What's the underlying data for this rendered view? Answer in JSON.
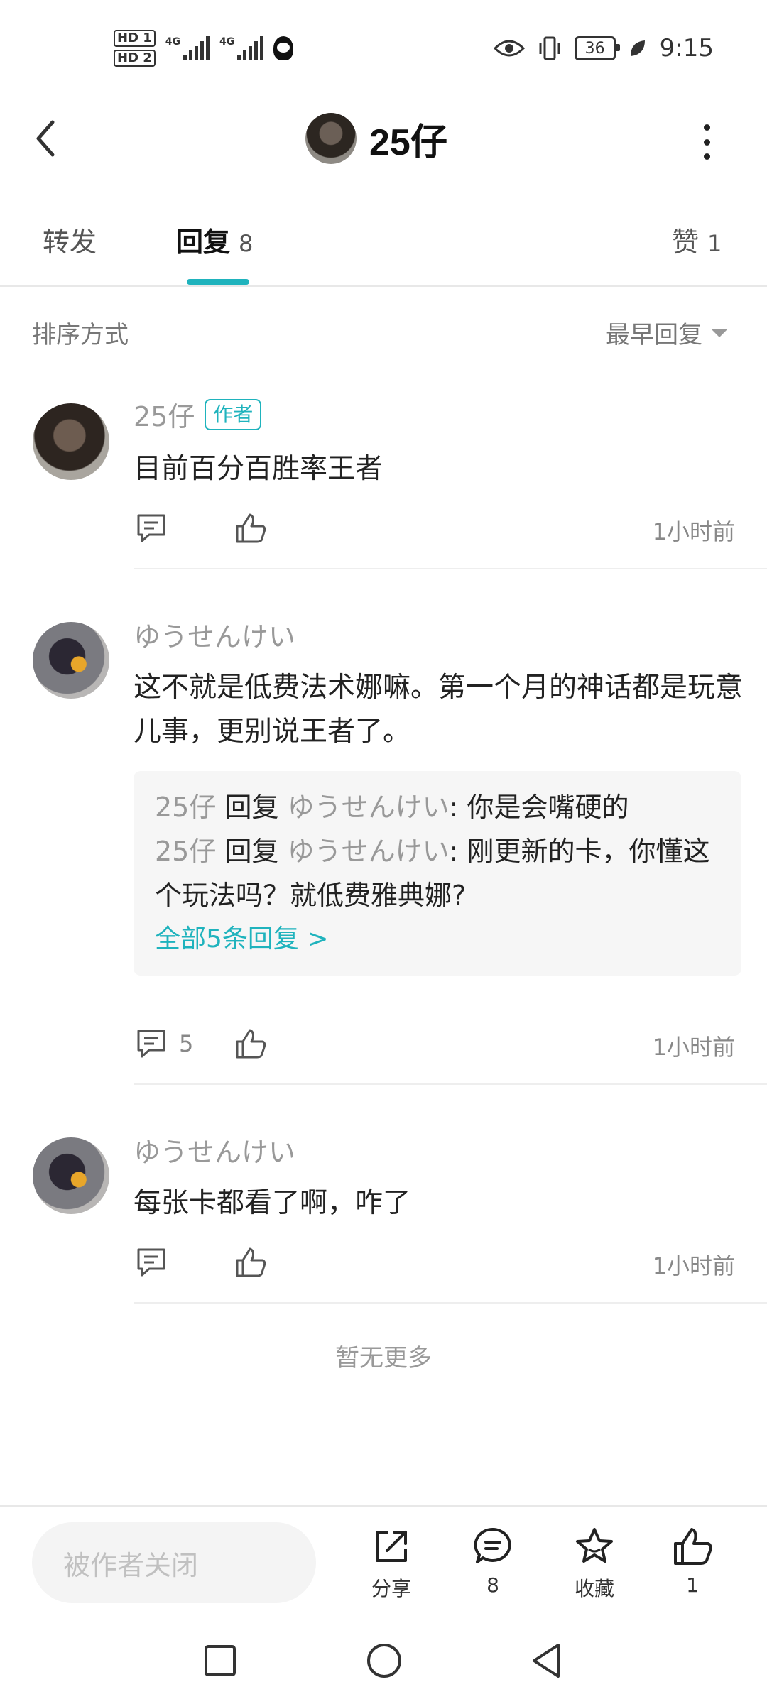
{
  "status_bar": {
    "hd1": "HD 1",
    "hd2": "HD 2",
    "net1": "4G",
    "net2": "4G",
    "battery": "36",
    "time": "9:15"
  },
  "header": {
    "title": "25仔"
  },
  "tabs": [
    {
      "label": "转发",
      "count": ""
    },
    {
      "label": "回复",
      "count": "8"
    },
    {
      "label": "赞",
      "count": "1"
    }
  ],
  "sort": {
    "label": "排序方式",
    "value": "最早回复"
  },
  "comments": [
    {
      "name": "25仔",
      "badge": "作者",
      "text": "目前百分百胜率王者",
      "time": "1小时前",
      "reply_count": ""
    },
    {
      "name": "ゆうせんけい",
      "text": "这不就是低费法术娜嘛。第一个月的神话都是玩意儿事，更别说王者了。",
      "time": "1小时前",
      "reply_count": "5",
      "replies": [
        {
          "from": "25仔",
          "verb": "回复",
          "to": "ゆうせんけい",
          "text": ": 你是会嘴硬的"
        },
        {
          "from": "25仔",
          "verb": "回复",
          "to": "ゆうせんけい",
          "text": ": 刚更新的卡，你懂这个玩法吗？就低费雅典娜?"
        }
      ],
      "more_replies": "全部5条回复 >"
    },
    {
      "name": "ゆうせんけい",
      "text": "每张卡都看了啊，咋了",
      "time": "1小时前",
      "reply_count": ""
    }
  ],
  "no_more": "暂无更多",
  "bottom_bar": {
    "input_placeholder": "被作者关闭",
    "share_label": "分享",
    "comment_count": "8",
    "favorite_label": "收藏",
    "like_count": "1"
  },
  "colors": {
    "accent": "#1fb3bd",
    "secondary_text": "#999999"
  }
}
